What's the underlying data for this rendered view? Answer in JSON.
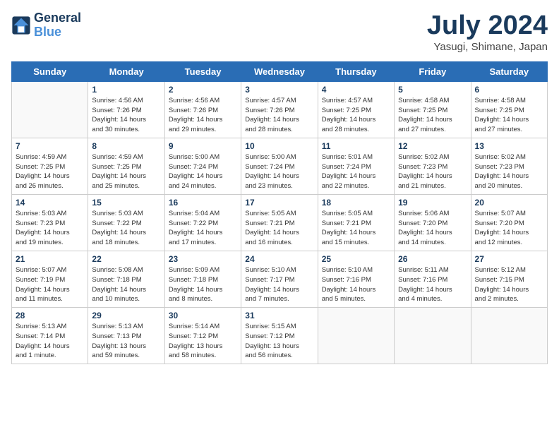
{
  "header": {
    "logo_line1": "General",
    "logo_line2": "Blue",
    "month": "July 2024",
    "location": "Yasugi, Shimane, Japan"
  },
  "days_of_week": [
    "Sunday",
    "Monday",
    "Tuesday",
    "Wednesday",
    "Thursday",
    "Friday",
    "Saturday"
  ],
  "weeks": [
    [
      {
        "day": "",
        "info": ""
      },
      {
        "day": "1",
        "info": "Sunrise: 4:56 AM\nSunset: 7:26 PM\nDaylight: 14 hours\nand 30 minutes."
      },
      {
        "day": "2",
        "info": "Sunrise: 4:56 AM\nSunset: 7:26 PM\nDaylight: 14 hours\nand 29 minutes."
      },
      {
        "day": "3",
        "info": "Sunrise: 4:57 AM\nSunset: 7:26 PM\nDaylight: 14 hours\nand 28 minutes."
      },
      {
        "day": "4",
        "info": "Sunrise: 4:57 AM\nSunset: 7:25 PM\nDaylight: 14 hours\nand 28 minutes."
      },
      {
        "day": "5",
        "info": "Sunrise: 4:58 AM\nSunset: 7:25 PM\nDaylight: 14 hours\nand 27 minutes."
      },
      {
        "day": "6",
        "info": "Sunrise: 4:58 AM\nSunset: 7:25 PM\nDaylight: 14 hours\nand 27 minutes."
      }
    ],
    [
      {
        "day": "7",
        "info": "Sunrise: 4:59 AM\nSunset: 7:25 PM\nDaylight: 14 hours\nand 26 minutes."
      },
      {
        "day": "8",
        "info": "Sunrise: 4:59 AM\nSunset: 7:25 PM\nDaylight: 14 hours\nand 25 minutes."
      },
      {
        "day": "9",
        "info": "Sunrise: 5:00 AM\nSunset: 7:24 PM\nDaylight: 14 hours\nand 24 minutes."
      },
      {
        "day": "10",
        "info": "Sunrise: 5:00 AM\nSunset: 7:24 PM\nDaylight: 14 hours\nand 23 minutes."
      },
      {
        "day": "11",
        "info": "Sunrise: 5:01 AM\nSunset: 7:24 PM\nDaylight: 14 hours\nand 22 minutes."
      },
      {
        "day": "12",
        "info": "Sunrise: 5:02 AM\nSunset: 7:23 PM\nDaylight: 14 hours\nand 21 minutes."
      },
      {
        "day": "13",
        "info": "Sunrise: 5:02 AM\nSunset: 7:23 PM\nDaylight: 14 hours\nand 20 minutes."
      }
    ],
    [
      {
        "day": "14",
        "info": "Sunrise: 5:03 AM\nSunset: 7:23 PM\nDaylight: 14 hours\nand 19 minutes."
      },
      {
        "day": "15",
        "info": "Sunrise: 5:03 AM\nSunset: 7:22 PM\nDaylight: 14 hours\nand 18 minutes."
      },
      {
        "day": "16",
        "info": "Sunrise: 5:04 AM\nSunset: 7:22 PM\nDaylight: 14 hours\nand 17 minutes."
      },
      {
        "day": "17",
        "info": "Sunrise: 5:05 AM\nSunset: 7:21 PM\nDaylight: 14 hours\nand 16 minutes."
      },
      {
        "day": "18",
        "info": "Sunrise: 5:05 AM\nSunset: 7:21 PM\nDaylight: 14 hours\nand 15 minutes."
      },
      {
        "day": "19",
        "info": "Sunrise: 5:06 AM\nSunset: 7:20 PM\nDaylight: 14 hours\nand 14 minutes."
      },
      {
        "day": "20",
        "info": "Sunrise: 5:07 AM\nSunset: 7:20 PM\nDaylight: 14 hours\nand 12 minutes."
      }
    ],
    [
      {
        "day": "21",
        "info": "Sunrise: 5:07 AM\nSunset: 7:19 PM\nDaylight: 14 hours\nand 11 minutes."
      },
      {
        "day": "22",
        "info": "Sunrise: 5:08 AM\nSunset: 7:18 PM\nDaylight: 14 hours\nand 10 minutes."
      },
      {
        "day": "23",
        "info": "Sunrise: 5:09 AM\nSunset: 7:18 PM\nDaylight: 14 hours\nand 8 minutes."
      },
      {
        "day": "24",
        "info": "Sunrise: 5:10 AM\nSunset: 7:17 PM\nDaylight: 14 hours\nand 7 minutes."
      },
      {
        "day": "25",
        "info": "Sunrise: 5:10 AM\nSunset: 7:16 PM\nDaylight: 14 hours\nand 5 minutes."
      },
      {
        "day": "26",
        "info": "Sunrise: 5:11 AM\nSunset: 7:16 PM\nDaylight: 14 hours\nand 4 minutes."
      },
      {
        "day": "27",
        "info": "Sunrise: 5:12 AM\nSunset: 7:15 PM\nDaylight: 14 hours\nand 2 minutes."
      }
    ],
    [
      {
        "day": "28",
        "info": "Sunrise: 5:13 AM\nSunset: 7:14 PM\nDaylight: 14 hours\nand 1 minute."
      },
      {
        "day": "29",
        "info": "Sunrise: 5:13 AM\nSunset: 7:13 PM\nDaylight: 13 hours\nand 59 minutes."
      },
      {
        "day": "30",
        "info": "Sunrise: 5:14 AM\nSunset: 7:12 PM\nDaylight: 13 hours\nand 58 minutes."
      },
      {
        "day": "31",
        "info": "Sunrise: 5:15 AM\nSunset: 7:12 PM\nDaylight: 13 hours\nand 56 minutes."
      },
      {
        "day": "",
        "info": ""
      },
      {
        "day": "",
        "info": ""
      },
      {
        "day": "",
        "info": ""
      }
    ]
  ]
}
